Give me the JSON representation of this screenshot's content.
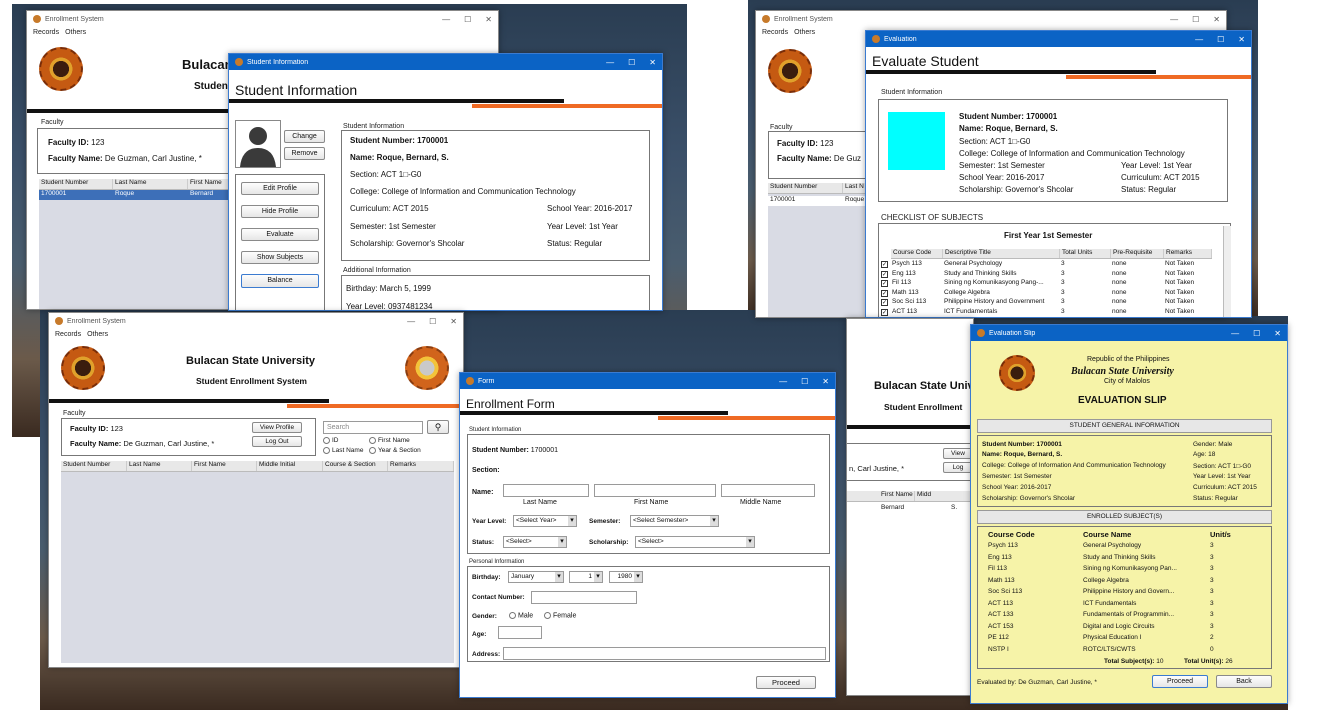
{
  "colors": {
    "accent": "#ef6a24",
    "titlebar": "#0b63c5",
    "slip": "#f6f3a8",
    "swatch": "#00ffff"
  },
  "university": "Bulacan State University",
  "system": "Student Enrollment System",
  "shotA": {
    "main": {
      "title": "Enrollment System",
      "menu": [
        "Records",
        "Others"
      ],
      "header_partial": "Bulacan",
      "sub_partial": "Student",
      "faculty_label": "Faculty",
      "faculty_id_label": "Faculty ID:",
      "faculty_id": "123",
      "faculty_name_label": "Faculty Name:",
      "faculty_name": "De Guzman, Carl Justine, *",
      "columns": [
        "Student Number",
        "Last Name",
        "First Name"
      ],
      "row": [
        "1700001",
        "Roque",
        "Bernard"
      ]
    },
    "info": {
      "title": "Student Information",
      "heading": "Student Information",
      "change": "Change",
      "remove": "Remove",
      "buttons": [
        "Edit Profile",
        "Hide Profile",
        "Evaluate",
        "Show Subjects",
        "Balance"
      ],
      "section_label": "Student Information",
      "student_number": "Student Number: 1700001",
      "name": "Name: Roque, Bernard, S.",
      "section": "Section: ACT 1□-G0",
      "college": "College: College of Information and Communication Technology",
      "curriculum": "Curriculum: ACT 2015",
      "school_year": "School Year: 2016-2017",
      "semester": "Semester: 1st Semester",
      "year_level": "Year Level: 1st Year",
      "scholarship": "Scholarship: Governor's Shcolar",
      "status": "Status: Regular",
      "additional_label": "Additional Information",
      "birthday": "Birthday: March 5, 1999",
      "year_level2": "Year Level: 0937481234"
    }
  },
  "shotB": {
    "main": {
      "title": "Enrollment System",
      "menu": [
        "Records",
        "Others"
      ],
      "faculty_label": "Faculty",
      "faculty_id_label": "Faculty ID:",
      "faculty_id": "123",
      "faculty_name_label": "Faculty Name:",
      "faculty_name": "De Guz",
      "columns": [
        "Student Number",
        "Last N"
      ],
      "row": [
        "1700001",
        "Roque"
      ]
    },
    "eval": {
      "title": "Evaluation",
      "heading": "Evaluate Student",
      "section_label": "Student Information",
      "student_number": "Student Number: 1700001",
      "name": "Name: Roque, Bernard, S.",
      "section": "Section: ACT 1□-G0",
      "college": "College: College of Information and Communication Technology",
      "semester": "Semester: 1st Semester",
      "year_level": "Year Level: 1st Year",
      "school_year": "School Year: 2016-2017",
      "curriculum": "Curriculum: ACT 2015",
      "scholarship": "Scholarship: Governor's Shcolar",
      "status": "Status: Regular",
      "checklist_label": "CHECKLIST OF SUBJECTS",
      "term": "First Year 1st Semester",
      "columns": [
        "Course Code",
        "Descriptive Title",
        "Total Units",
        "Pre-Requisite",
        "Remarks"
      ],
      "rows": [
        [
          "Psych 113",
          "General Psychology",
          "3",
          "none",
          "Not Taken"
        ],
        [
          "Eng 113",
          "Study and Thinking Skills",
          "3",
          "none",
          "Not Taken"
        ],
        [
          "Fil 113",
          "Sining ng Komunikasyong Pang-...",
          "3",
          "none",
          "Not Taken"
        ],
        [
          "Math 113",
          "College Algebra",
          "3",
          "none",
          "Not Taken"
        ],
        [
          "Soc Sci 113",
          "Philippine History and Government",
          "3",
          "none",
          "Not Taken"
        ],
        [
          "ACT 113",
          "ICT Fundamentals",
          "3",
          "none",
          "Not Taken"
        ]
      ]
    }
  },
  "shotC": {
    "main": {
      "title": "Enrollment System",
      "menu": [
        "Records",
        "Others"
      ],
      "faculty_label": "Faculty",
      "faculty_id_label": "Faculty ID:",
      "faculty_id": "123",
      "faculty_name_label": "Faculty Name:",
      "faculty_name": "De Guzman, Carl Justine, *",
      "view_profile": "View Profile",
      "log_out": "Log Out",
      "search_placeholder": "Search",
      "radios": [
        "ID",
        "First Name",
        "Last Name",
        "Year & Section"
      ],
      "columns": [
        "Student Number",
        "Last Name",
        "First Name",
        "Middle Initial",
        "Course & Section",
        "Remarks"
      ]
    },
    "form": {
      "title": "Form",
      "heading": "Enrollment Form",
      "student_info_label": "Student Information",
      "student_number_label": "Student Number:",
      "student_number": "1700001",
      "section_label": "Section:",
      "name_label": "Name:",
      "last_name": "Last Name",
      "first_name": "First Name",
      "middle_name": "Middle Name",
      "year_level_label": "Year Level:",
      "year_select": "<Select Year>",
      "semester_label": "Semester:",
      "semester_select": "<Select Semester>",
      "status_label": "Status:",
      "status_select": "<Select>",
      "scholarship_label": "Scholarship:",
      "scholarship_select": "<Select>",
      "personal_label": "Personal Information",
      "birthday_label": "Birthday:",
      "month": "January",
      "day": "1",
      "year": "1980",
      "contact_label": "Contact Number:",
      "gender_label": "Gender:",
      "male": "Male",
      "female": "Female",
      "age_label": "Age:",
      "address_label": "Address:",
      "proceed": "Proceed"
    }
  },
  "shotD": {
    "main": {
      "header_partial": "Bulacan State Univ",
      "sub_partial": "Student Enrollment",
      "faculty_name_partial": "n, Carl Justine, *",
      "view": "View",
      "log": "Log",
      "columns": [
        "First Name",
        "Midd"
      ],
      "row": [
        "Bernard",
        "S."
      ]
    },
    "slip": {
      "title": "Evaluation Slip",
      "republic": "Republic of the Philippines",
      "city": "City of Malolos",
      "heading": "EVALUATION SLIP",
      "general_label": "STUDENT GENERAL INFORMATION",
      "student_number": "Student Number: 1700001",
      "gender": "Gender: Male",
      "name": "Name: Roque, Bernard, S.",
      "age": "Age: 18",
      "college": "College: College of Information And Communication Technology",
      "section": "Section: ACT 1□-G0",
      "semester": "Semester: 1st Semester",
      "year_level": "Year Level: 1st Year",
      "school_year": "School Year: 2016-2017",
      "curriculum": "Curriculum: ACT 2015",
      "scholarship": "Scholarship: Governor's Shcolar",
      "status": "Status: Regular",
      "enrolled_label": "ENROLLED SUBJECT(S)",
      "columns": [
        "Course Code",
        "Course Name",
        "Unit/s"
      ],
      "rows": [
        [
          "Psych 113",
          "General Psychology",
          "3"
        ],
        [
          "Eng 113",
          "Study and Thinking Skills",
          "3"
        ],
        [
          "Fil 113",
          "Sining ng Komunikasyong Pan...",
          "3"
        ],
        [
          "Math 113",
          "College Algebra",
          "3"
        ],
        [
          "Soc Sci 113",
          "Philippine History and Govern...",
          "3"
        ],
        [
          "ACT 113",
          "ICT Fundamentals",
          "3"
        ],
        [
          "ACT 133",
          "Fundamentals of Programmin...",
          "3"
        ],
        [
          "ACT 153",
          "Digital and Logic Circuits",
          "3"
        ],
        [
          "PE 112",
          "Physical Education I",
          "2"
        ],
        [
          "NSTP I",
          "ROTC/LTS/CWTS",
          "0"
        ]
      ],
      "total_subjects_label": "Total Subject(s):",
      "total_subjects": "10",
      "total_units_label": "Total Unit(s):",
      "total_units": "26",
      "evaluated_by": "Evaluated by: De Guzman, Carl Justine, *",
      "proceed": "Proceed",
      "back": "Back"
    }
  }
}
